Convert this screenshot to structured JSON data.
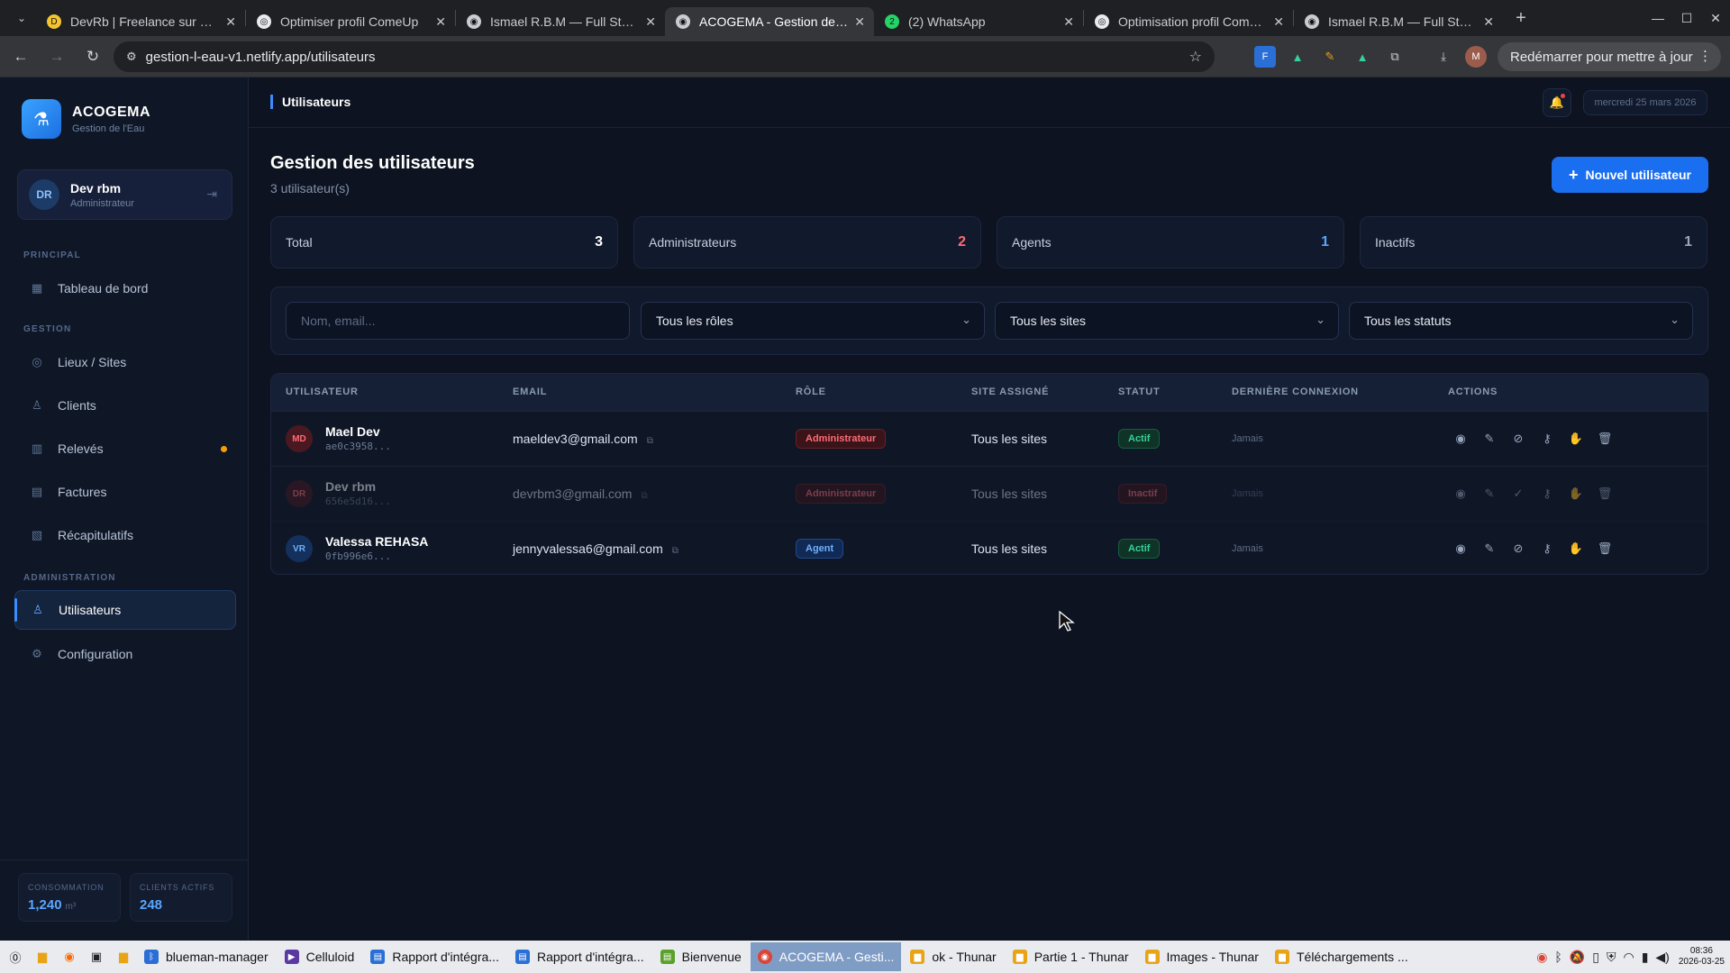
{
  "browser": {
    "tabs": [
      {
        "title": "DevRb | Freelance sur ComeUp",
        "favicon_color": "#f4c430",
        "favicon_letter": "D"
      },
      {
        "title": "Optimiser profil ComeUp",
        "favicon_color": "#e8eaed",
        "favicon_letter": "◎"
      },
      {
        "title": "Ismael R.B.M — Full Stack Dev",
        "favicon_color": "#c9ccd1",
        "favicon_letter": "◉"
      },
      {
        "title": "ACOGEMA - Gestion de l'Eau",
        "favicon_color": "#c9ccd1",
        "favicon_letter": "◉"
      },
      {
        "title": "(2) WhatsApp",
        "favicon_color": "#25d366",
        "favicon_letter": "2"
      },
      {
        "title": "Optimisation profil ComeUp",
        "favicon_color": "#e8eaed",
        "favicon_letter": "◎"
      },
      {
        "title": "Ismael R.B.M — Full Stack Dev",
        "favicon_color": "#c9ccd1",
        "favicon_letter": "◉"
      }
    ],
    "active_tab": 3,
    "url": "gestion-l-eau-v1.netlify.app/utilisateurs",
    "profile_letter": "M",
    "restart_label": "Redémarrer pour mettre à jour"
  },
  "sidebar": {
    "brand_name": "ACOGEMA",
    "brand_sub": "Gestion de l'Eau",
    "user": {
      "initials": "DR",
      "name": "Dev rbm",
      "role": "Administrateur"
    },
    "sections": {
      "principal": "PRINCIPAL",
      "gestion": "GESTION",
      "administration": "ADMINISTRATION"
    },
    "items": {
      "dashboard": "Tableau de bord",
      "sites": "Lieux / Sites",
      "clients": "Clients",
      "releves": "Relevés",
      "factures": "Factures",
      "recap": "Récapitulatifs",
      "users": "Utilisateurs",
      "config": "Configuration"
    },
    "footer": {
      "consumption_label": "CONSOMMATION",
      "consumption_value": "1,240",
      "consumption_unit": "m³",
      "clients_label": "CLIENTS ACTIFS",
      "clients_value": "248"
    }
  },
  "topbar": {
    "breadcrumb": "Utilisateurs",
    "date": "mercredi 25 mars 2026"
  },
  "page": {
    "title": "Gestion des utilisateurs",
    "subtitle": "3 utilisateur(s)",
    "new_button": "Nouvel utilisateur"
  },
  "stats": [
    {
      "label": "Total",
      "value": "3",
      "color": "#ffffff"
    },
    {
      "label": "Administrateurs",
      "value": "2",
      "color": "#ff6b76"
    },
    {
      "label": "Agents",
      "value": "1",
      "color": "#5aa6ff"
    },
    {
      "label": "Inactifs",
      "value": "1",
      "color": "#9aa8bf"
    }
  ],
  "filters": {
    "search_placeholder": "Nom, email...",
    "role": "Tous les rôles",
    "site": "Tous les sites",
    "status": "Tous les statuts"
  },
  "table": {
    "headers": [
      "UTILISATEUR",
      "EMAIL",
      "RÔLE",
      "SITE ASSIGNÉ",
      "STATUT",
      "DERNIÈRE CONNEXION",
      "ACTIONS"
    ],
    "rows": [
      {
        "initials": "MD",
        "name": "Mael Dev",
        "id": "ae0c3958...",
        "email": "maeldev3@gmail.com",
        "role": "Administrateur",
        "site": "Tous les sites",
        "status": "Actif",
        "last": "Jamais"
      },
      {
        "initials": "DR",
        "name": "Dev rbm",
        "id": "656e5d16...",
        "email": "devrbm3@gmail.com",
        "role": "Administrateur",
        "site": "Tous les sites",
        "status": "Inactif",
        "last": "Jamais"
      },
      {
        "initials": "VR",
        "name": "Valessa REHASA",
        "id": "0fb996e6...",
        "email": "jennyvalessa6@gmail.com",
        "role": "Agent",
        "site": "Tous les sites",
        "status": "Actif",
        "last": "Jamais"
      }
    ]
  },
  "taskbar": {
    "items": [
      "blueman-manager",
      "Celluloid",
      "Rapport d'intégra...",
      "Rapport d'intégra...",
      "Bienvenue",
      "ACOGEMA - Gesti...",
      "ok - Thunar",
      "Partie 1 - Thunar",
      "Images - Thunar",
      "Téléchargements ..."
    ],
    "active_index": 5,
    "time": "08:36",
    "date": "2026-03-25"
  }
}
